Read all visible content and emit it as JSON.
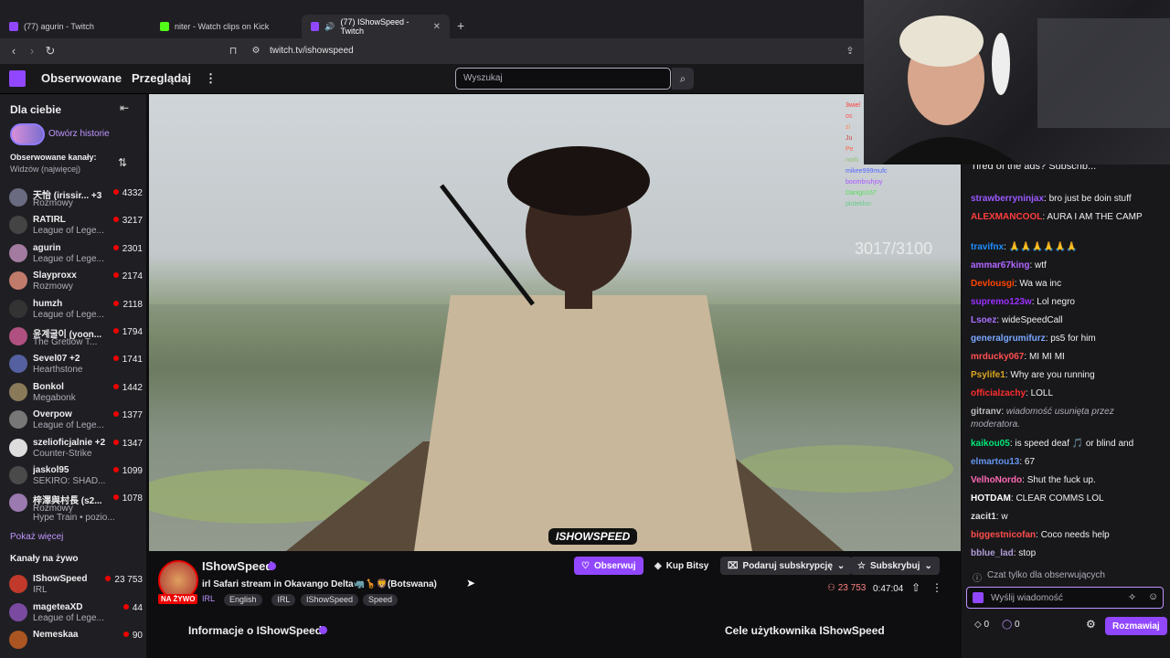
{
  "browser": {
    "tabs": [
      {
        "title": "(77) agurin - Twitch",
        "color": "#9147ff"
      },
      {
        "title": "niter - Watch clips on Kick",
        "color": "#53fc18"
      },
      {
        "title": "(77) IShowSpeed - Twitch",
        "color": "#9147ff"
      }
    ],
    "new_tab": "+",
    "url": "twitch.tv/ishowspeed"
  },
  "topnav": {
    "following": "Obserwowane",
    "browse": "Przeglądaj",
    "more": "⋮",
    "search_placeholder": "Wyszukaj"
  },
  "sidebar": {
    "for_you": "Dla ciebie",
    "collapse": "⇤",
    "stories": "Otwórz historie",
    "followed_title": "Obserwowane kanały:",
    "followed_sort": "Widzów (najwięcej)",
    "sort_icon": "⇅",
    "channels": [
      {
        "name": "天怡 (irissir... +3",
        "game": "Rozmowy",
        "viewers": "4332",
        "color": "#6a6a80"
      },
      {
        "name": "RATIRL",
        "game": "League of Lege...",
        "viewers": "3217",
        "color": "#444"
      },
      {
        "name": "agurin",
        "game": "League of Lege...",
        "viewers": "2301",
        "color": "#a37aa0"
      },
      {
        "name": "Slayproxx",
        "game": "Rozmowy",
        "viewers": "2174",
        "color": "#c07b6b"
      },
      {
        "name": "humzh",
        "game": "League of Lege...",
        "viewers": "2118",
        "color": "#333"
      },
      {
        "name": "윤계굴이 (yoon...",
        "game": "The Gretlow T...",
        "viewers": "1794",
        "color": "#b05080"
      },
      {
        "name": "Sevel07 +2",
        "game": "Hearthstone",
        "viewers": "1741",
        "color": "#5560a0"
      },
      {
        "name": "Bonkol",
        "game": "Megabonk",
        "viewers": "1442",
        "color": "#8a7a5a"
      },
      {
        "name": "Overpow",
        "game": "League of Lege...",
        "viewers": "1377",
        "color": "#777"
      },
      {
        "name": "szelioficjalnie +2",
        "game": "Counter-Strike",
        "viewers": "1347",
        "color": "#ddd"
      },
      {
        "name": "jaskol95",
        "game": "SEKIRO: SHAD...",
        "viewers": "1099",
        "color": "#4a4a4a"
      },
      {
        "name": "梓澤與村長 (s2...",
        "game": "Rozmowy",
        "viewers": "1078",
        "color": "#9b7ab0"
      }
    ],
    "hype_train": "Hype Train • pozio...",
    "show_more": "Pokaż więcej",
    "live_title": "Kanały na żywo",
    "live_channels": [
      {
        "name": "IShowSpeed",
        "game": "IRL",
        "viewers": "23 753",
        "color": "#c0392b"
      },
      {
        "name": "mageteaXD",
        "game": "League of Lege...",
        "viewers": "44",
        "color": "#7a4aa0"
      },
      {
        "name": "Nemeskaa",
        "game": "",
        "viewers": "90",
        "color": "#aa5522"
      }
    ]
  },
  "video": {
    "watermark": "ISHOWSPEED",
    "counter": "3017/3100",
    "overlay_chat": [
      "3wiel",
      "os",
      "zi",
      "Ju",
      "Pe",
      "norb",
      "",
      "mikee999mufc",
      "boombruhjoy",
      "Danigo167",
      "ploteklon"
    ]
  },
  "stream": {
    "streamer": "IShowSpeed",
    "live_badge": "NA ŻYWO",
    "title": "irl Safari stream in Okavango Delta🦏🦒🦁(Botswana)",
    "category": "IRL",
    "tags": [
      "English",
      "IRL",
      "IShowSpeed",
      "Speed"
    ],
    "follow": "Obserwuj",
    "bits": "Kup Bitsy",
    "gift": "Podaruj subskrypcję",
    "subscribe": "Subskrybuj",
    "viewers": "23 753",
    "uptime": "0:47:04",
    "about": "Informacje o IShowSpeed",
    "goals": "Cele użytkownika IShowSpeed"
  },
  "chat": {
    "ad_banner": "Tired of the ads? Subscrib...",
    "messages": [
      {
        "user": "strawberryninjax",
        "text": "bro just be doin stuff",
        "color": "#9b59ff"
      },
      {
        "user": "ALEXMANCOOL",
        "text": "AURA I AM THE CAMP",
        "color": "#ff3d3d"
      },
      {
        "user": "travifnx",
        "text": "🙏🙏🙏🙏🙏🙏",
        "color": "#1e90ff"
      },
      {
        "user": "ammar67king",
        "text": "wtf",
        "color": "#b266ff"
      },
      {
        "user": "Devlousgi",
        "text": "Wa wa inc",
        "color": "#ff4500"
      },
      {
        "user": "supremo123w",
        "text": "Lol negro",
        "color": "#9b30ff"
      },
      {
        "user": "Lsoez",
        "text": "wideSpeedCall",
        "color": "#a970ff"
      },
      {
        "user": "generalgrumifurz",
        "text": "ps5 for him",
        "color": "#7aa7ff"
      },
      {
        "user": "mrducky067",
        "text": "MI MI MI",
        "color": "#ff4f4f"
      },
      {
        "user": "Psylife1",
        "text": "Why are you running",
        "color": "#daa520"
      },
      {
        "user": "officialzachy",
        "text": "LOLL",
        "color": "#ff2d2d"
      },
      {
        "user": "gitranv",
        "text": "wiadomość usunięta przez moderatora.",
        "color": "#bbbbbb"
      },
      {
        "user": "kaikou05",
        "text": "is speed deaf 🎵 or blind and",
        "color": "#00e676"
      },
      {
        "user": "elmartou13",
        "text": "67",
        "color": "#6495ed"
      },
      {
        "user": "VelhoNordo",
        "text": "Shut the fuck up.",
        "color": "#ff69b4"
      },
      {
        "user": "HOTDAM",
        "text": "CLEAR COMMS LOL",
        "color": "#ffffff"
      },
      {
        "user": "zacit1",
        "text": "w",
        "color": "#dddddd"
      },
      {
        "user": "biggestnicofan",
        "text": "Coco needs help",
        "color": "#ff4d4d"
      },
      {
        "user": "bblue_lad",
        "text": "stop",
        "color": "#b19cd9"
      }
    ],
    "followers_only": "Czat tylko dla obserwujących",
    "input_placeholder": "Wyślij wiadomość",
    "bits_count": "0",
    "points_count": "0",
    "send": "Rozmawiaj"
  }
}
